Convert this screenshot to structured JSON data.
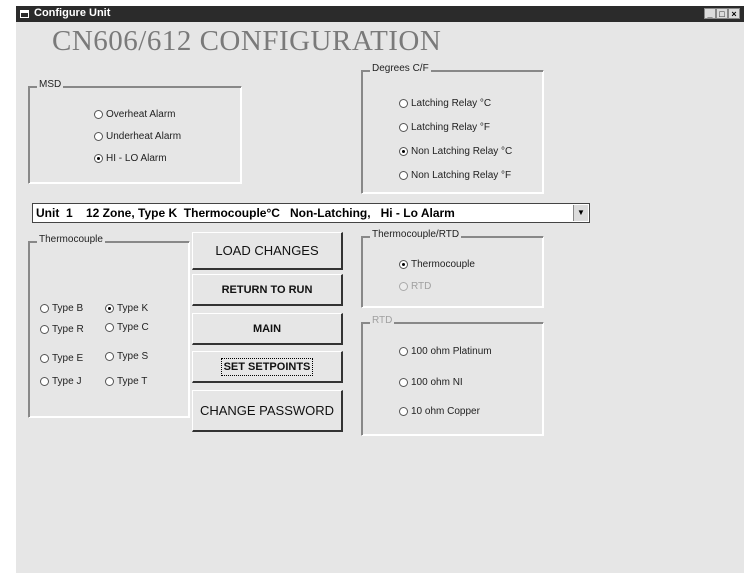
{
  "window": {
    "title": "Configure Unit",
    "controls": [
      "_",
      "□",
      "×"
    ]
  },
  "header": {
    "title": "CN606/612 CONFIGURATION"
  },
  "msd": {
    "title": "MSD",
    "options": [
      {
        "label": "Overheat Alarm",
        "selected": false
      },
      {
        "label": "Underheat Alarm",
        "selected": false
      },
      {
        "label": "HI - LO Alarm",
        "selected": true
      }
    ]
  },
  "degrees": {
    "title": "Degrees C/F",
    "options": [
      {
        "label": "Latching Relay °C",
        "selected": false
      },
      {
        "label": "Latching Relay °F",
        "selected": false
      },
      {
        "label": "Non Latching Relay °C",
        "selected": true
      },
      {
        "label": "Non Latching Relay °F",
        "selected": false
      }
    ]
  },
  "unit_select": {
    "value": "Unit  1    12 Zone, Type K  Thermocouple°C   Non-Latching,   Hi - Lo Alarm"
  },
  "thermocouple": {
    "title": "Thermocouple",
    "options": [
      {
        "label": "Type B",
        "selected": false
      },
      {
        "label": "Type K",
        "selected": true
      },
      {
        "label": "Type R",
        "selected": false
      },
      {
        "label": "Type C",
        "selected": false
      },
      {
        "label": "Type E",
        "selected": false
      },
      {
        "label": "Type S",
        "selected": false
      },
      {
        "label": "Type J",
        "selected": false
      },
      {
        "label": "Type T",
        "selected": false
      }
    ]
  },
  "buttons": {
    "load_changes": "LOAD CHANGES",
    "return_to_run": "RETURN TO RUN",
    "main": "MAIN",
    "set_setpoints": "SET SETPOINTS",
    "change_password": "CHANGE PASSWORD"
  },
  "sensor_type": {
    "title": "Thermocouple/RTD",
    "options": [
      {
        "label": "Thermocouple",
        "selected": true
      },
      {
        "label": "RTD",
        "selected": false,
        "disabled": true
      }
    ]
  },
  "rtd": {
    "title": "RTD",
    "options": [
      {
        "label": "100 ohm Platinum",
        "selected": false
      },
      {
        "label": "100 ohm NI",
        "selected": false
      },
      {
        "label": "10 ohm Copper",
        "selected": false
      }
    ]
  }
}
